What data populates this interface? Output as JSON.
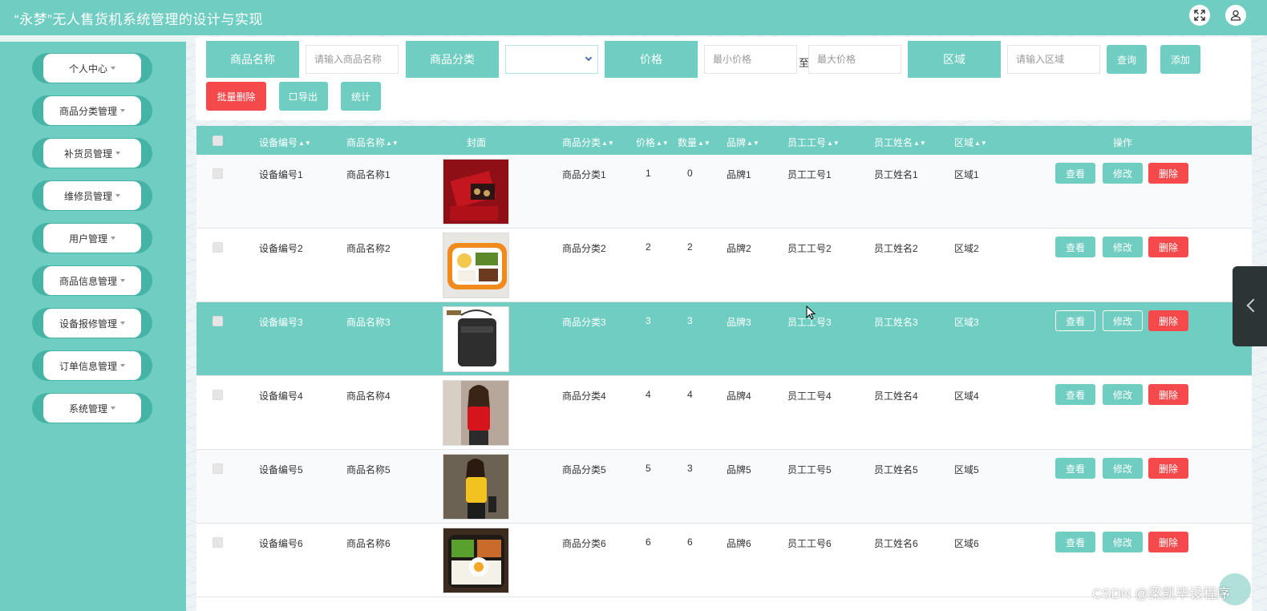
{
  "header": {
    "title": "“永梦”无人售货机系统管理的设计与实现",
    "fullscreen_icon": "expand-icon",
    "user_icon": "user-icon"
  },
  "sidebar": {
    "items": [
      {
        "label": "个人中心"
      },
      {
        "label": "商品分类管理"
      },
      {
        "label": "补货员管理"
      },
      {
        "label": "维修员管理"
      },
      {
        "label": "用户管理"
      },
      {
        "label": "商品信息管理"
      },
      {
        "label": "设备报修管理"
      },
      {
        "label": "订单信息管理"
      },
      {
        "label": "系统管理"
      }
    ]
  },
  "search": {
    "name_label": "商品名称",
    "name_placeholder": "请输入商品名称",
    "category_label": "商品分类",
    "category_value": "",
    "price_label": "价格",
    "min_price_placeholder": "最小价格",
    "to_text": "至",
    "max_price_placeholder": "最大价格",
    "region_label": "区域",
    "region_placeholder": "请输入区域",
    "query_button": "查询",
    "add_button": "添加",
    "batch_delete_button": "批量删除",
    "export_button": "导出",
    "stats_button": "统计"
  },
  "table": {
    "columns": [
      "设备编号",
      "商品名称",
      "封面",
      "商品分类",
      "价格",
      "数量",
      "品牌",
      "员工工号",
      "员工姓名",
      "区域",
      "操作"
    ],
    "actions": {
      "view": "查看",
      "edit": "修改",
      "delete": "删除"
    },
    "rows": [
      {
        "device_no": "设备编号1",
        "name": "商品名称1",
        "category": "商品分类1",
        "price": "1",
        "qty": "0",
        "brand": "品牌1",
        "emp_no": "员工工号1",
        "emp_name": "员工姓名1",
        "region": "区域1",
        "cover": "red-gift-box"
      },
      {
        "device_no": "设备编号2",
        "name": "商品名称2",
        "category": "商品分类2",
        "price": "2",
        "qty": "2",
        "brand": "品牌2",
        "emp_no": "员工工号2",
        "emp_name": "员工姓名2",
        "region": "区域2",
        "cover": "bento-box"
      },
      {
        "device_no": "设备编号3",
        "name": "商品名称3",
        "category": "商品分类3",
        "price": "3",
        "qty": "3",
        "brand": "品牌3",
        "emp_no": "员工工号3",
        "emp_name": "员工姓名3",
        "region": "区域3",
        "cover": "black-bag"
      },
      {
        "device_no": "设备编号4",
        "name": "商品名称4",
        "category": "商品分类4",
        "price": "4",
        "qty": "4",
        "brand": "品牌4",
        "emp_no": "员工工号4",
        "emp_name": "员工姓名4",
        "region": "区域4",
        "cover": "red-top-woman"
      },
      {
        "device_no": "设备编号5",
        "name": "商品名称5",
        "category": "商品分类5",
        "price": "5",
        "qty": "3",
        "brand": "品牌5",
        "emp_no": "员工工号5",
        "emp_name": "员工姓名5",
        "region": "区域5",
        "cover": "yellow-top-woman"
      },
      {
        "device_no": "设备编号6",
        "name": "商品名称6",
        "category": "商品分类6",
        "price": "6",
        "qty": "6",
        "brand": "品牌6",
        "emp_no": "员工工号6",
        "emp_name": "员工姓名6",
        "region": "区域6",
        "cover": "egg-rice-box"
      }
    ]
  },
  "watermark": "CSDN @梁凯毕设程序",
  "colors": {
    "accent": "#6fcdc1",
    "danger": "#f5494c",
    "background": "#eef3f5"
  }
}
